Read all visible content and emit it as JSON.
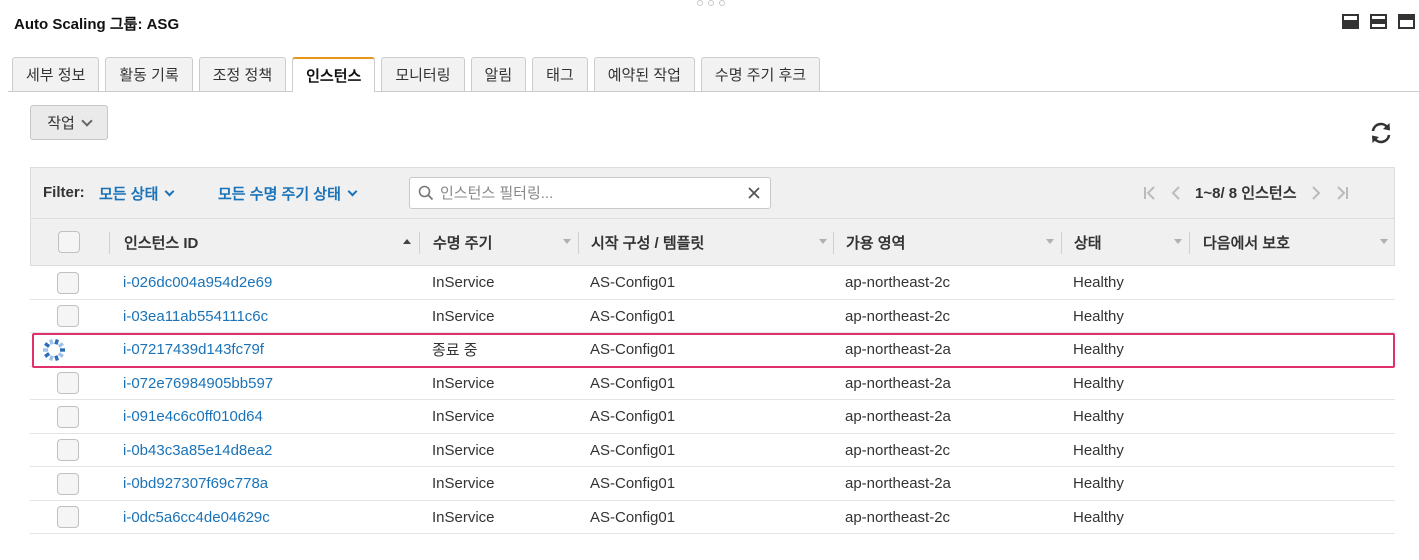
{
  "panel": {
    "title": "Auto Scaling 그룹: ASG"
  },
  "tabs": [
    {
      "label": "세부 정보",
      "active": false
    },
    {
      "label": "활동 기록",
      "active": false
    },
    {
      "label": "조정 정책",
      "active": false
    },
    {
      "label": "인스턴스",
      "active": true
    },
    {
      "label": "모니터링",
      "active": false
    },
    {
      "label": "알림",
      "active": false
    },
    {
      "label": "태그",
      "active": false
    },
    {
      "label": "예약된 작업",
      "active": false
    },
    {
      "label": "수명 주기 후크",
      "active": false
    }
  ],
  "toolbar": {
    "actions_label": "작업"
  },
  "filter": {
    "label": "Filter:",
    "state_dropdown": "모든 상태",
    "lifecycle_dropdown": "모든 수명 주기 상태",
    "search_placeholder": "인스턴스 필터링...",
    "search_value": "",
    "pager_text": "1~8/ 8 인스턴스"
  },
  "table": {
    "columns": {
      "instance_id": "인스턴스 ID",
      "lifecycle": "수명 주기",
      "launch_config": "시작 구성 / 템플릿",
      "az": "가용 영역",
      "status": "상태",
      "protection": "다음에서 보호"
    },
    "rows": [
      {
        "id": "i-026dc004a954d2e69",
        "lifecycle": "InService",
        "config": "AS-Config01",
        "az": "ap-northeast-2c",
        "status": "Healthy",
        "protection": "",
        "terminating": false
      },
      {
        "id": "i-03ea11ab554111c6c",
        "lifecycle": "InService",
        "config": "AS-Config01",
        "az": "ap-northeast-2c",
        "status": "Healthy",
        "protection": "",
        "terminating": false
      },
      {
        "id": "i-07217439d143fc79f",
        "lifecycle": "종료 중",
        "config": "AS-Config01",
        "az": "ap-northeast-2a",
        "status": "Healthy",
        "protection": "",
        "terminating": true
      },
      {
        "id": "i-072e76984905bb597",
        "lifecycle": "InService",
        "config": "AS-Config01",
        "az": "ap-northeast-2a",
        "status": "Healthy",
        "protection": "",
        "terminating": false
      },
      {
        "id": "i-091e4c6c0ff010d64",
        "lifecycle": "InService",
        "config": "AS-Config01",
        "az": "ap-northeast-2a",
        "status": "Healthy",
        "protection": "",
        "terminating": false
      },
      {
        "id": "i-0b43c3a85e14d8ea2",
        "lifecycle": "InService",
        "config": "AS-Config01",
        "az": "ap-northeast-2c",
        "status": "Healthy",
        "protection": "",
        "terminating": false
      },
      {
        "id": "i-0bd927307f69c778a",
        "lifecycle": "InService",
        "config": "AS-Config01",
        "az": "ap-northeast-2a",
        "status": "Healthy",
        "protection": "",
        "terminating": false
      },
      {
        "id": "i-0dc5a6cc4de04629c",
        "lifecycle": "InService",
        "config": "AS-Config01",
        "az": "ap-northeast-2c",
        "status": "Healthy",
        "protection": "",
        "terminating": false
      }
    ]
  },
  "colors": {
    "link": "#1a73b8",
    "active_tab_accent": "#e7961a",
    "highlight_border": "#e0316b"
  }
}
